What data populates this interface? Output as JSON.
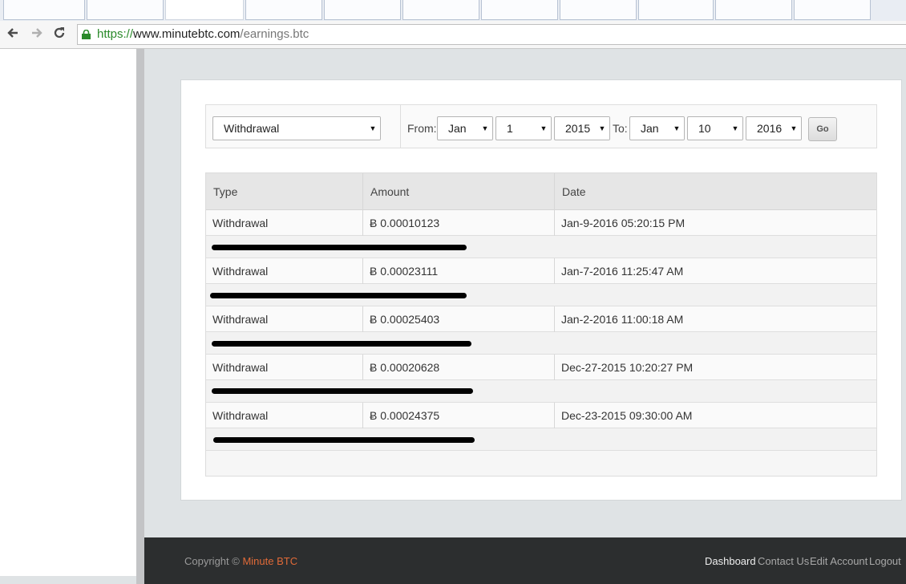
{
  "browser": {
    "url_scheme": "https://",
    "url_host": "www.minutebtc.com",
    "url_path": "/earnings.btc",
    "back_icon": "arrow-left-icon",
    "forward_icon": "arrow-right-icon",
    "reload_icon": "reload-icon",
    "lock_color": "#2a8a2a"
  },
  "filters": {
    "type_value": "Withdrawal",
    "from_label": "From:",
    "from_month": "Jan",
    "from_day": "1",
    "from_year": "2015",
    "to_label": "To:",
    "to_month": "Jan",
    "to_day": "10",
    "to_year": "2016",
    "go_label": "Go"
  },
  "table": {
    "headers": [
      "Type",
      "Amount",
      "Date"
    ],
    "rows": [
      {
        "type": "Withdrawal",
        "amount": "Ƀ 0.00010123",
        "date": "Jan-9-2016 05:20:15 PM"
      },
      {
        "type": "Withdrawal",
        "amount": "Ƀ 0.00023111",
        "date": "Jan-7-2016 11:25:47 AM"
      },
      {
        "type": "Withdrawal",
        "amount": "Ƀ 0.00025403",
        "date": "Jan-2-2016 11:00:18 AM"
      },
      {
        "type": "Withdrawal",
        "amount": "Ƀ 0.00020628",
        "date": "Dec-27-2015 10:20:27 PM"
      },
      {
        "type": "Withdrawal",
        "amount": "Ƀ 0.00024375",
        "date": "Dec-23-2015 09:30:00 AM"
      }
    ]
  },
  "footer": {
    "copyright_prefix": "Copyright © ",
    "brand": "Minute BTC",
    "brand_color": "#e06a38",
    "links": [
      "Dashboard",
      "Contact Us",
      "Edit Account",
      "Logout"
    ]
  }
}
